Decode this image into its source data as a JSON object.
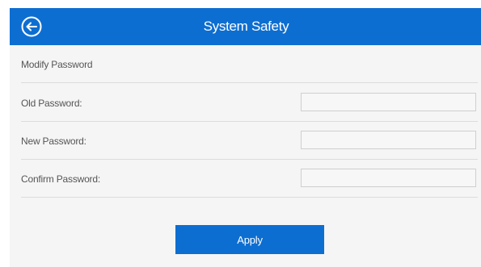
{
  "header": {
    "title": "System Safety",
    "back_icon": "back-arrow-circle-icon",
    "background_color": "#0d6ed1"
  },
  "form": {
    "section_title": "Modify Password",
    "fields": [
      {
        "label": "Old Password:",
        "value": ""
      },
      {
        "label": "New Password:",
        "value": ""
      },
      {
        "label": "Confirm Password:",
        "value": ""
      }
    ],
    "apply_label": "Apply"
  }
}
